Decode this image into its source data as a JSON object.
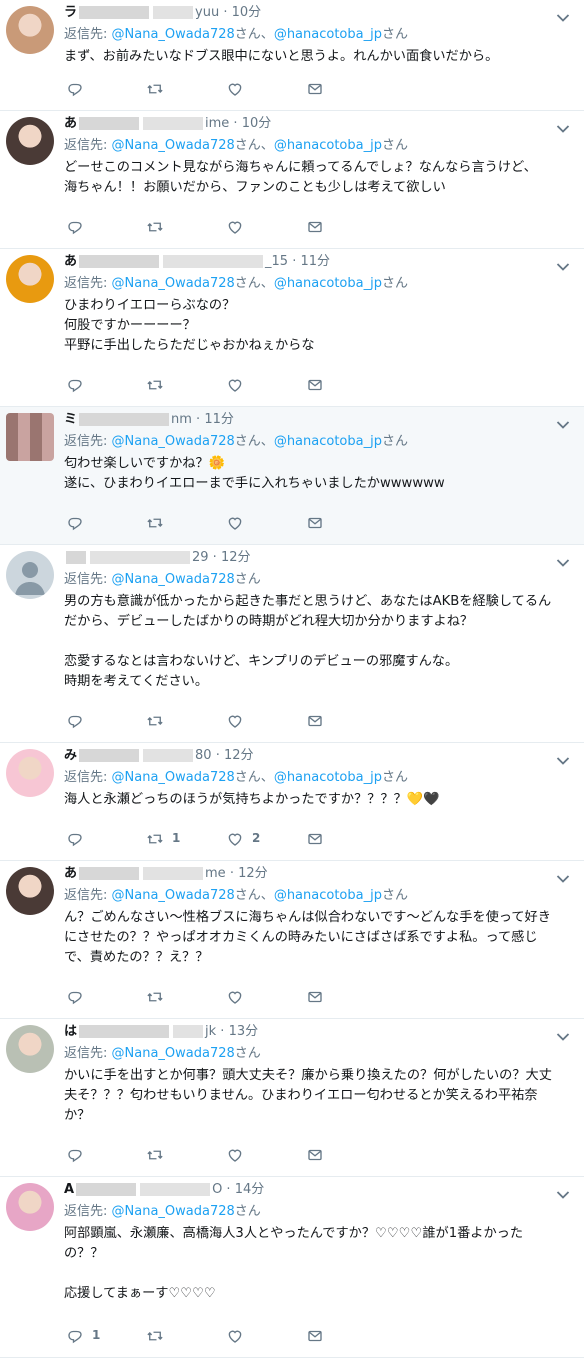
{
  "tweets": [
    {
      "name_start": "ラ",
      "name_end": "yuu",
      "time": "10分",
      "mentions": [
        "@Nana_Owada728",
        "@hanacotoba_jp"
      ],
      "text": "まず、お前みたいなドブス眼中にないと思うよ。れんかい面食いだから。",
      "replies": "",
      "retweets": "",
      "likes": "",
      "avatar": "#c99a78"
    },
    {
      "name_start": "あ",
      "name_end": "ime",
      "time": "10分",
      "mentions": [
        "@Nana_Owada728",
        "@hanacotoba_jp"
      ],
      "text": "どーせこのコメント見ながら海ちゃんに頼ってるんでしょ？なんなら言うけど、\n海ちゃん！！お願いだから、ファンのことも少しは考えて欲しい",
      "replies": "",
      "retweets": "",
      "likes": "",
      "avatar": "#4a3a36"
    },
    {
      "name_start": "あ",
      "name_end": "_15",
      "time": "11分",
      "mentions": [
        "@Nana_Owada728",
        "@hanacotoba_jp"
      ],
      "text": "ひまわりイエローらぶなの？\n何股ですかーーーー？\n平野に手出したらただじゃおかねぇからな",
      "replies": "",
      "retweets": "",
      "likes": "",
      "avatar": "#e89a10"
    },
    {
      "name_start": "ミ",
      "name_end": "nm",
      "time": "11分",
      "mentions": [
        "@Nana_Owada728",
        "@hanacotoba_jp"
      ],
      "text": "匂わせ楽しいですかね？🌼\n遂に、ひまわりイエローまで手に入れちゃいましたかwwwwww",
      "replies": "",
      "retweets": "",
      "likes": "",
      "avatar": "#9a7570"
    },
    {
      "name_start": "",
      "name_end": "29",
      "time": "12分",
      "mentions": [
        "@Nana_Owada728"
      ],
      "text": "男の方も意識が低かったから起きた事だと思うけど、あなたはAKBを経験してるんだから、デビューしたばかりの時期がどれ程大切か分かりますよね？\n\n恋愛するなとは言わないけど、キンプリのデビューの邪魔すんな。\n時期を考えてください。",
      "replies": "",
      "retweets": "",
      "likes": "",
      "avatar": "#ccd6dd"
    },
    {
      "name_start": "み",
      "name_end": "80",
      "time": "12分",
      "mentions": [
        "@Nana_Owada728",
        "@hanacotoba_jp"
      ],
      "text": "海人と永瀬どっちのほうが気持ちよかったですか？？？？💛🖤",
      "replies": "",
      "retweets": "1",
      "likes": "2",
      "avatar": "#f7c6d4"
    },
    {
      "name_start": "あ",
      "name_end": "me",
      "time": "12分",
      "mentions": [
        "@Nana_Owada728",
        "@hanacotoba_jp"
      ],
      "text": "ん？ごめんなさい～性格ブスに海ちゃんは似合わないです～どんな手を使って好きにさせたの？？やっぱオオカミくんの時みたいにさばさば系ですよ私。って感じで、責めたの？？え？？",
      "replies": "",
      "retweets": "",
      "likes": "",
      "avatar": "#4a3a36"
    },
    {
      "name_start": "は",
      "name_end": "jk",
      "time": "13分",
      "mentions": [
        "@Nana_Owada728"
      ],
      "text": "かいに手を出すとか何事？頭大丈夫そ？廉から乗り換えたの？何がしたいの？大丈夫そ？？？匂わせもいりません。ひまわりイエロー匂わせるとか笑えるわ平祐奈か？",
      "replies": "",
      "retweets": "",
      "likes": "",
      "avatar": "#b9c0b4"
    },
    {
      "name_start": "A",
      "name_end": "O",
      "time": "14分",
      "mentions": [
        "@Nana_Owada728"
      ],
      "text": "阿部顕嵐、永瀬廉、高橋海人3人とやったんですか？♡♡♡♡誰が1番よかったの？？\n\n応援してまぁーす♡♡♡♡",
      "replies": "1",
      "retweets": "",
      "likes": "",
      "avatar": "#e7a6c6"
    }
  ],
  "ui": {
    "reply_prefix": "返信先: ",
    "san": "さん",
    "sep": "、"
  },
  "icons": [
    "reply-icon",
    "retweet-icon",
    "like-icon",
    "dm-icon",
    "chevron-down-icon"
  ]
}
